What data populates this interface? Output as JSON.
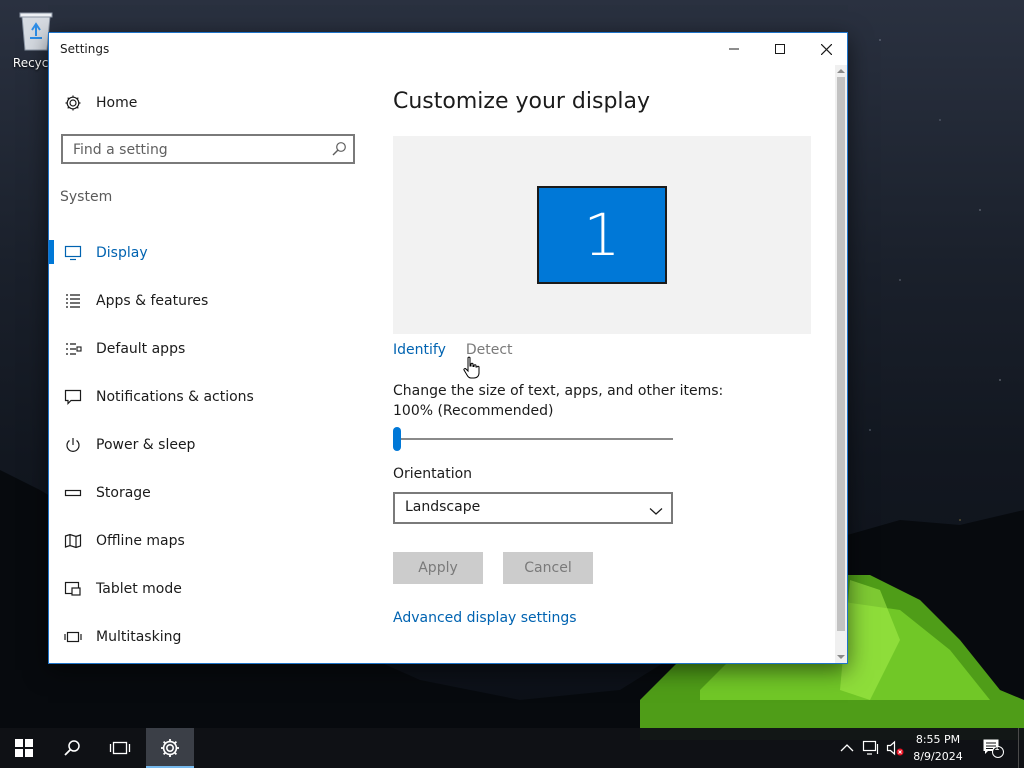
{
  "desktop": {
    "recycle_bin_label": "Recycle"
  },
  "window": {
    "title": "Settings",
    "minimize_icon": "minimize-icon",
    "maximize_icon": "maximize-icon",
    "close_icon": "close-icon"
  },
  "sidebar": {
    "home_label": "Home",
    "search_placeholder": "Find a setting",
    "section_label": "System",
    "items": [
      {
        "label": "Display",
        "icon": "monitor-icon",
        "active": true
      },
      {
        "label": "Apps & features",
        "icon": "list-icon",
        "active": false
      },
      {
        "label": "Default apps",
        "icon": "default-apps-icon",
        "active": false
      },
      {
        "label": "Notifications & actions",
        "icon": "message-icon",
        "active": false
      },
      {
        "label": "Power & sleep",
        "icon": "power-icon",
        "active": false
      },
      {
        "label": "Storage",
        "icon": "drive-icon",
        "active": false
      },
      {
        "label": "Offline maps",
        "icon": "map-icon",
        "active": false
      },
      {
        "label": "Tablet mode",
        "icon": "tablet-icon",
        "active": false
      },
      {
        "label": "Multitasking",
        "icon": "multitasking-icon",
        "active": false
      }
    ]
  },
  "main": {
    "title": "Customize your display",
    "monitor_number": "1",
    "identify_label": "Identify",
    "detect_label": "Detect",
    "scale_label": "Change the size of text, apps, and other items: 100% (Recommended)",
    "scale_slider_fraction": 0.0,
    "orientation_label": "Orientation",
    "orientation_value": "Landscape",
    "apply_label": "Apply",
    "cancel_label": "Cancel",
    "advanced_link": "Advanced display settings"
  },
  "taskbar": {
    "time": "8:55 PM",
    "date": "8/9/2024",
    "notification_count": "1"
  },
  "colors": {
    "accent": "#0078d7",
    "link": "#0063b1"
  }
}
